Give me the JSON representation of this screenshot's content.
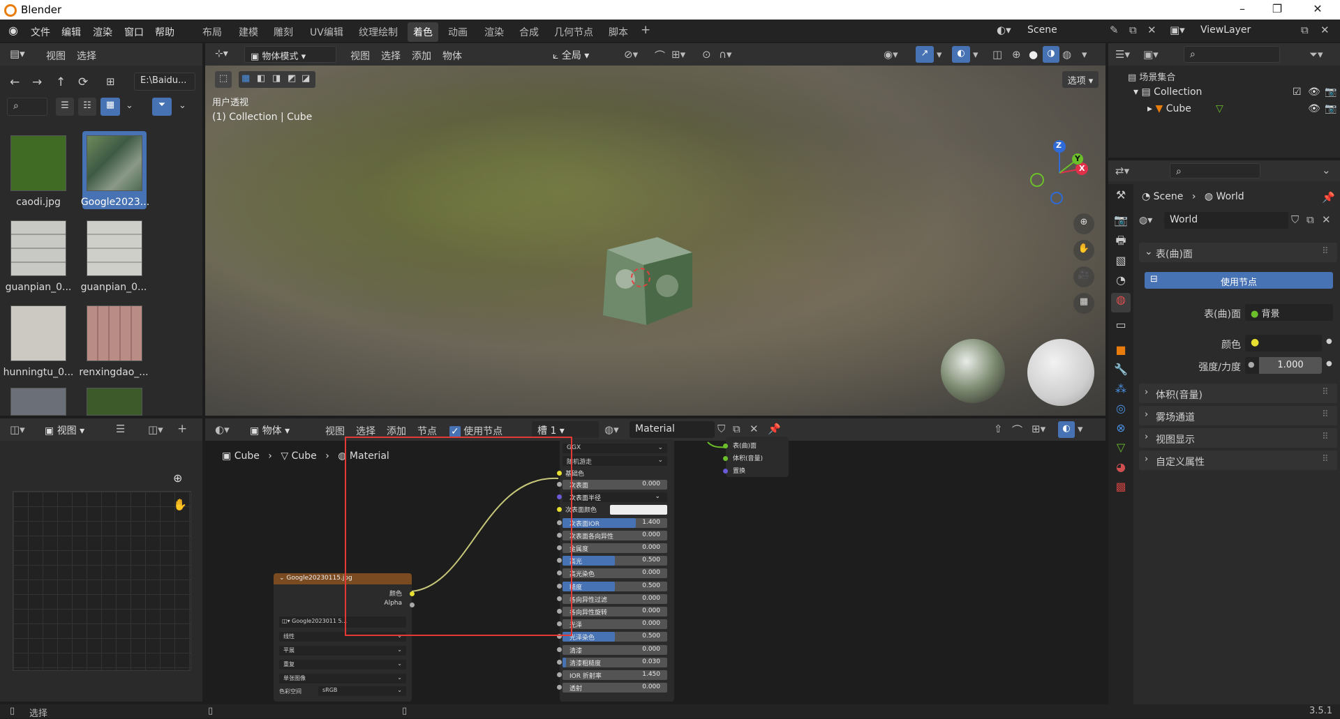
{
  "window": {
    "title": "Blender",
    "min": "–",
    "max": "❐",
    "close": "✕"
  },
  "menu": [
    "文件",
    "编辑",
    "渲染",
    "窗口",
    "帮助"
  ],
  "workspaces": [
    "布局",
    "建模",
    "雕刻",
    "UV编辑",
    "纹理绘制",
    "着色",
    "动画",
    "渲染",
    "合成",
    "几何节点",
    "脚本",
    "+"
  ],
  "active_workspace": 5,
  "scene_field": "Scene",
  "viewlayer_field": "ViewLayer",
  "file_browser": {
    "view": "视图",
    "select": "选择",
    "path": "E:\\Baidu...",
    "items": [
      {
        "name": "caodi.jpg",
        "color": "#3f6b25"
      },
      {
        "name": "Google2023...",
        "color": "#4e6a52"
      },
      {
        "name": "guanpian_0...",
        "color": "#c8c8c4"
      },
      {
        "name": "guanpian_0...",
        "color": "#cfcfca"
      },
      {
        "name": "hunningtu_0...",
        "color": "#cbc9c2"
      },
      {
        "name": "renxingdao_...",
        "color": "#b98c85"
      }
    ]
  },
  "viewport": {
    "mode": "物体模式",
    "menus": [
      "视图",
      "选择",
      "添加",
      "物体"
    ],
    "orientation": "全局",
    "options": "选项",
    "overlay_title": "用户透视",
    "overlay_sub": "(1) Collection | Cube",
    "gizmo": {
      "x": "X",
      "y": "Y",
      "z": "Z"
    }
  },
  "outliner": {
    "root": "场景集合",
    "collection": "Collection",
    "object": "Cube"
  },
  "properties": {
    "scene": "Scene",
    "world_crumb": "World",
    "world_field": "World",
    "surface_panel": "表(曲)面",
    "use_nodes": "使用节点",
    "surface_label": "表(曲)面",
    "surface_value": "背景",
    "color_label": "颜色",
    "strength_label": "强度/力度",
    "strength_value": "1.000",
    "panels": [
      "体积(音量)",
      "雾场通道",
      "视图显示",
      "自定义属性"
    ]
  },
  "image_editor": {
    "view": "视图"
  },
  "node_editor": {
    "object": "物体",
    "menus": [
      "视图",
      "选择",
      "添加",
      "节点"
    ],
    "use_nodes": "使用节点",
    "slot": "槽 1",
    "material": "Material",
    "breadcrumb": [
      "Cube",
      "Cube",
      "Material"
    ],
    "image_node": {
      "title": "Google20230115.jpg",
      "out_color": "颜色",
      "out_alpha": "Alpha",
      "image_field": "Google2023011 5...",
      "rows": [
        "线性",
        "平展",
        "重复",
        "单张图像"
      ],
      "colorspace_label": "色彩空间",
      "colorspace_value": "sRGB"
    },
    "bsdf": {
      "dist": "GGX",
      "sss_method": "随机游走",
      "base_color": "基础色",
      "rows": [
        {
          "label": "次表面",
          "value": "0.000",
          "fill": 0
        },
        {
          "label": "次表面半径",
          "value": "",
          "fill": 0,
          "dropdown": true
        },
        {
          "label": "次表面颜色",
          "value": "",
          "fill": 0,
          "color": true
        },
        {
          "label": "次表面IOR",
          "value": "1.400",
          "fill": 0.7
        },
        {
          "label": "次表面各向异性",
          "value": "0.000",
          "fill": 0
        },
        {
          "label": "金属度",
          "value": "0.000",
          "fill": 0
        },
        {
          "label": "高光",
          "value": "0.500",
          "fill": 0.5
        },
        {
          "label": "高光染色",
          "value": "0.000",
          "fill": 0
        },
        {
          "label": "糙度",
          "value": "0.500",
          "fill": 0.5
        },
        {
          "label": "各向异性过滤",
          "value": "0.000",
          "fill": 0
        },
        {
          "label": "各向异性旋转",
          "value": "0.000",
          "fill": 0
        },
        {
          "label": "光泽",
          "value": "0.000",
          "fill": 0
        },
        {
          "label": "光泽染色",
          "value": "0.500",
          "fill": 0.5
        },
        {
          "label": "清漆",
          "value": "0.000",
          "fill": 0
        },
        {
          "label": "清漆粗糙度",
          "value": "0.030",
          "fill": 0.03
        },
        {
          "label": "IOR 折射率",
          "value": "1.450",
          "fill": 0
        },
        {
          "label": "透射",
          "value": "0.000",
          "fill": 0
        }
      ]
    },
    "output_node": [
      "表(曲)面",
      "体积(音量)",
      "置换"
    ]
  },
  "status": {
    "left": "选择",
    "version": "3.5.1"
  },
  "colors": {
    "accent": "#4772b3",
    "highlight": "#e53935"
  }
}
